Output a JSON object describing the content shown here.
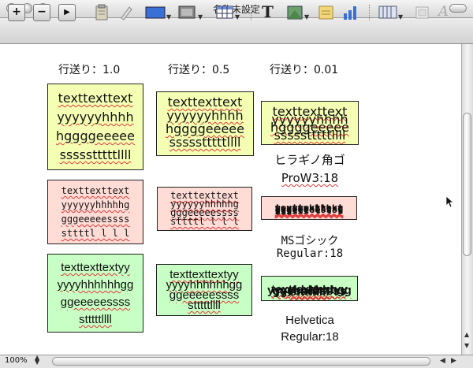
{
  "window": {
    "title": "名称未設定"
  },
  "toolbar": {
    "plus": "+",
    "minus": "−",
    "play": "▶",
    "text_tool": "T",
    "font_size_glyph": "A"
  },
  "columns": [
    {
      "header": "行送り：1.0"
    },
    {
      "header": "行送り：0.5"
    },
    {
      "header": "行送り：0.01"
    }
  ],
  "col1": {
    "yellow": [
      "texttexttext",
      "yyyyyyhhhh",
      "hggggeeeee",
      "ssssstttttllll"
    ],
    "pink": [
      "texttexttext",
      "yyyyyyhhhhhg",
      "gggeeeeessss",
      "sttttl l l l"
    ],
    "green": [
      "texttexttextyy",
      "yyyyhhhhhhgg",
      "ggeeeeessss",
      "stttttllll"
    ]
  },
  "col2": {
    "yellow": [
      "texttexttext",
      "yyyyyyhhhh",
      "hggggeeeee",
      "ssssstttttllll"
    ],
    "pink": [
      "texttexttext",
      "yyyyyyhhhhhg",
      "gggeeeeessss",
      "sttttl l l l"
    ],
    "green": [
      "texttexttextyy",
      "yyyyhhhhhhgg",
      "ggeeeeessss",
      "stttttllll"
    ]
  },
  "col3": {
    "yellow": [
      "texttexttext",
      "yyyyyyhhhh",
      "hggggeeeee",
      "ssssstttttllll"
    ],
    "pink": [
      "texttexttext",
      "yyyyyyhhhhhg",
      "gggeeeeessss",
      "sttttl l l l"
    ],
    "green": [
      "texttexttextyy",
      "yyyyhhhhhhgg",
      "ggeeeeessss",
      "stttttllll"
    ]
  },
  "font_labels": {
    "hiragino": [
      "ヒラギノ角ゴ",
      "ProW3:18"
    ],
    "ms_gothic": [
      "MSゴシック",
      "Regular:18"
    ],
    "helvetica": [
      "Helvetica",
      "Regular:18"
    ]
  },
  "status": {
    "zoom": "100%"
  },
  "colors": {
    "yellow": "#f5ffb4",
    "pink": "#ffdcd6",
    "green": "#c8ffc4"
  }
}
